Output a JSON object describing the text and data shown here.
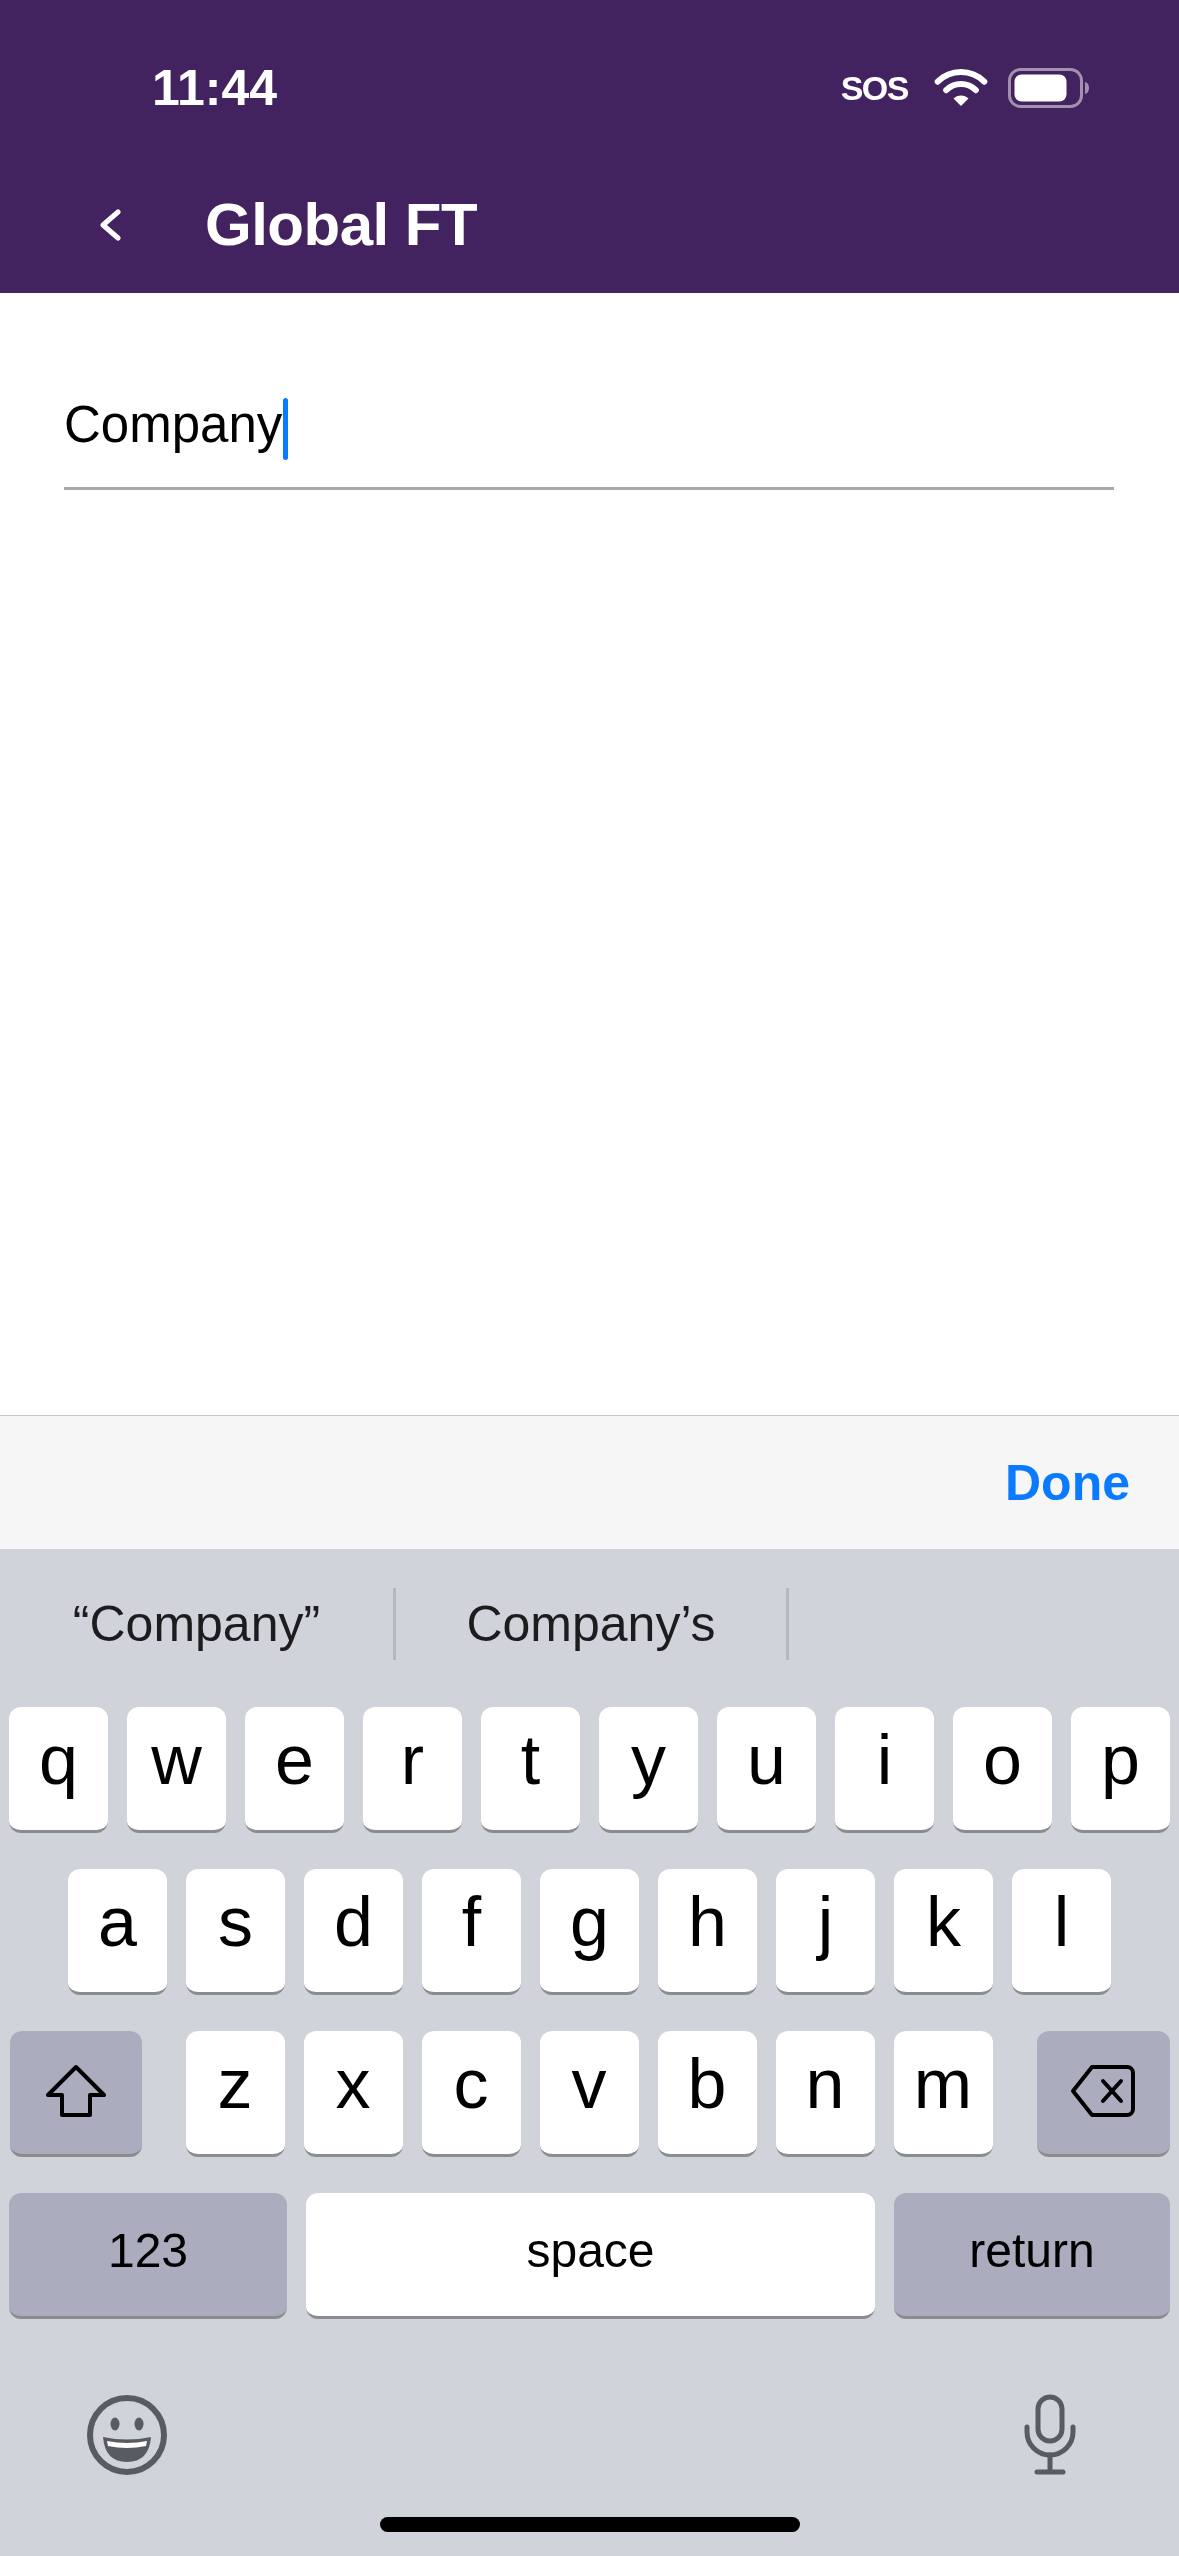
{
  "status_bar": {
    "time": "11:44",
    "network": "SOS"
  },
  "nav_bar": {
    "title": "Global FT"
  },
  "form": {
    "field": {
      "value": "Company",
      "focused": true
    }
  },
  "keyboard_toolbar": {
    "done_button": "Done"
  },
  "keyboard": {
    "suggestions": [
      "“Company”",
      "Company’s"
    ],
    "rows": [
      {
        "keys": [
          {
            "kind": "letter",
            "label": "q"
          },
          {
            "kind": "letter",
            "label": "w"
          },
          {
            "kind": "letter",
            "label": "e"
          },
          {
            "kind": "letter",
            "label": "r"
          },
          {
            "kind": "letter",
            "label": "t"
          },
          {
            "kind": "letter",
            "label": "y"
          },
          {
            "kind": "letter",
            "label": "u"
          },
          {
            "kind": "letter",
            "label": "i"
          },
          {
            "kind": "letter",
            "label": "o"
          },
          {
            "kind": "letter",
            "label": "p"
          }
        ]
      },
      {
        "keys": [
          {
            "kind": "letter",
            "label": "a"
          },
          {
            "kind": "letter",
            "label": "s"
          },
          {
            "kind": "letter",
            "label": "d"
          },
          {
            "kind": "letter",
            "label": "f"
          },
          {
            "kind": "letter",
            "label": "g"
          },
          {
            "kind": "letter",
            "label": "h"
          },
          {
            "kind": "letter",
            "label": "j"
          },
          {
            "kind": "letter",
            "label": "k"
          },
          {
            "kind": "letter",
            "label": "l"
          }
        ]
      },
      {
        "keys": [
          {
            "kind": "shift"
          },
          {
            "kind": "letter",
            "label": "z"
          },
          {
            "kind": "letter",
            "label": "x"
          },
          {
            "kind": "letter",
            "label": "c"
          },
          {
            "kind": "letter",
            "label": "v"
          },
          {
            "kind": "letter",
            "label": "b"
          },
          {
            "kind": "letter",
            "label": "n"
          },
          {
            "kind": "letter",
            "label": "m"
          },
          {
            "kind": "delete"
          }
        ]
      },
      {
        "keys": [
          {
            "kind": "mode",
            "label": "123"
          },
          {
            "kind": "space",
            "label": "space"
          },
          {
            "kind": "return",
            "label": "return"
          }
        ]
      }
    ]
  }
}
